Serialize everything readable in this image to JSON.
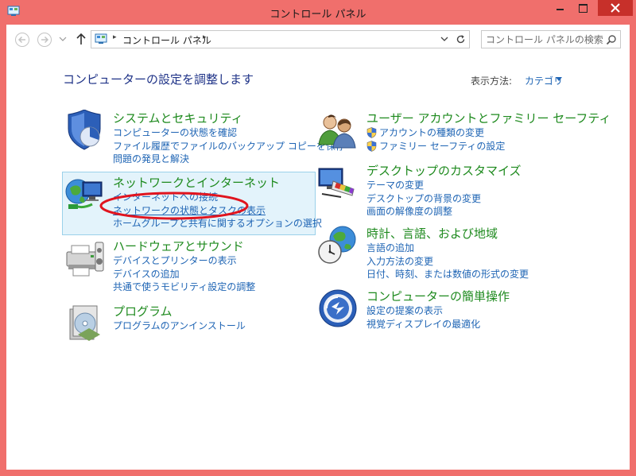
{
  "window": {
    "title": "コントロール パネル"
  },
  "address_bar": {
    "path": "コントロール パネル",
    "chevron": "▸"
  },
  "search": {
    "placeholder": "コントロール パネルの検索"
  },
  "header": {
    "title": "コンピューターの設定を調整します",
    "view_label": "表示方法:",
    "view_value": "カテゴリ"
  },
  "categories": {
    "system": {
      "title": "システムとセキュリティ",
      "links": [
        "コンピューターの状態を確認",
        "ファイル履歴でファイルのバックアップ コピーを保存",
        "問題の発見と解決"
      ]
    },
    "network": {
      "title": "ネットワークとインターネット",
      "links": [
        "インターネットへの接続",
        "ネットワークの状態とタスクの表示",
        "ホームグループと共有に関するオプションの選択"
      ]
    },
    "hardware": {
      "title": "ハードウェアとサウンド",
      "links": [
        "デバイスとプリンターの表示",
        "デバイスの追加",
        "共通で使うモビリティ設定の調整"
      ]
    },
    "programs": {
      "title": "プログラム",
      "links": [
        "プログラムのアンインストール"
      ]
    },
    "users": {
      "title": "ユーザー アカウントとファミリー セーフティ",
      "links": [
        "アカウントの種類の変更",
        "ファミリー セーフティの設定"
      ]
    },
    "appearance": {
      "title": "デスクトップのカスタマイズ",
      "links": [
        "テーマの変更",
        "デスクトップの背景の変更",
        "画面の解像度の調整"
      ]
    },
    "clock": {
      "title": "時計、言語、および地域",
      "links": [
        "言語の追加",
        "入力方法の変更",
        "日付、時刻、または数値の形式の変更"
      ]
    },
    "ease": {
      "title": "コンピューターの簡単操作",
      "links": [
        "設定の提案の表示",
        "視覚ディスプレイの最適化"
      ]
    }
  },
  "colors": {
    "title_bar": "#f06f6c",
    "category_title": "#1e8a1e",
    "link": "#1e64b4",
    "page_title": "#1e3287",
    "highlight_bg": "#e3f3fb",
    "annotation": "#e0141e"
  }
}
